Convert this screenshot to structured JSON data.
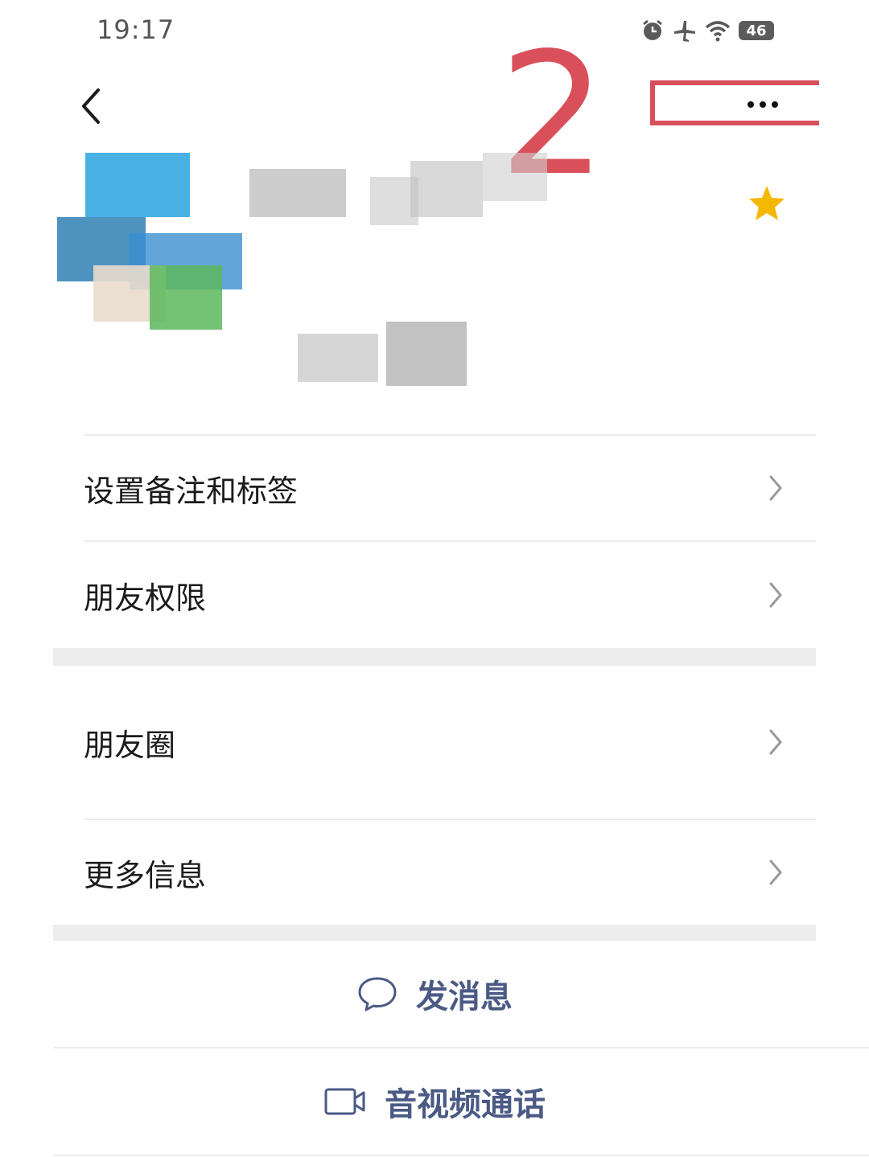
{
  "status_bar": {
    "time": "19:17",
    "icons": [
      "alarm-icon",
      "airplane-icon",
      "wifi-icon",
      "battery-icon"
    ],
    "battery": "46"
  },
  "header": {
    "annotation_number": "2",
    "annotation_color": "#d9505a",
    "back_icon": "chevron-left-icon",
    "more_icon": "more-dots-icon"
  },
  "profile": {
    "starred": true,
    "star_color": "#f5b800"
  },
  "menu": {
    "items": [
      {
        "label": "设置备注和标签"
      },
      {
        "label": "朋友权限"
      },
      {
        "label": "朋友圈"
      },
      {
        "label": "更多信息"
      }
    ]
  },
  "actions": {
    "message": {
      "label": "发消息",
      "icon": "chat-bubble-icon"
    },
    "call": {
      "label": "音视频通话",
      "icon": "video-camera-icon"
    },
    "color": "#4a5a84"
  }
}
